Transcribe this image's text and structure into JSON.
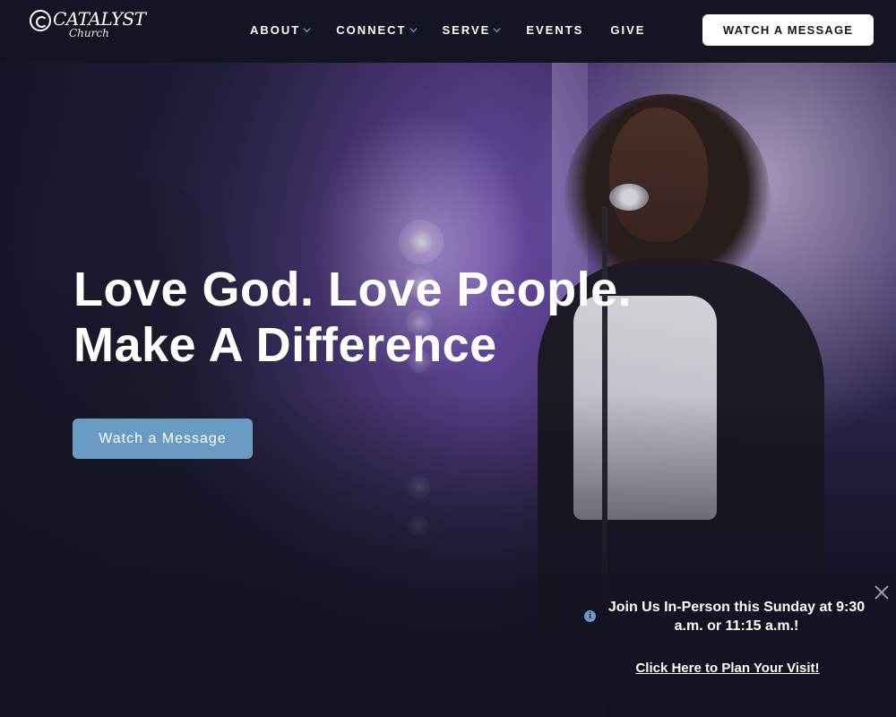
{
  "brand": {
    "name": "CATALYST",
    "sub": "Church"
  },
  "nav": {
    "items": [
      {
        "label": "ABOUT",
        "dropdown": true
      },
      {
        "label": "CONNECT",
        "dropdown": true
      },
      {
        "label": "SERVE",
        "dropdown": true
      },
      {
        "label": "EVENTS",
        "dropdown": false
      },
      {
        "label": "GIVE",
        "dropdown": false
      }
    ],
    "cta_label": "WATCH A MESSAGE"
  },
  "hero": {
    "headline_line1": "Love God. Love People.",
    "headline_line2": "Make A Difference",
    "cta_label": "Watch a Message"
  },
  "notice": {
    "message": "Join Us In-Person this Sunday at 9:30 a.m. or 11:15 a.m.!",
    "link_label": "Click Here to Plan Your Visit!",
    "info_icon": "i"
  },
  "colors": {
    "nav_bg": "#141522",
    "accent": "#6a9bc2",
    "chevron": "#6a9bc2"
  }
}
